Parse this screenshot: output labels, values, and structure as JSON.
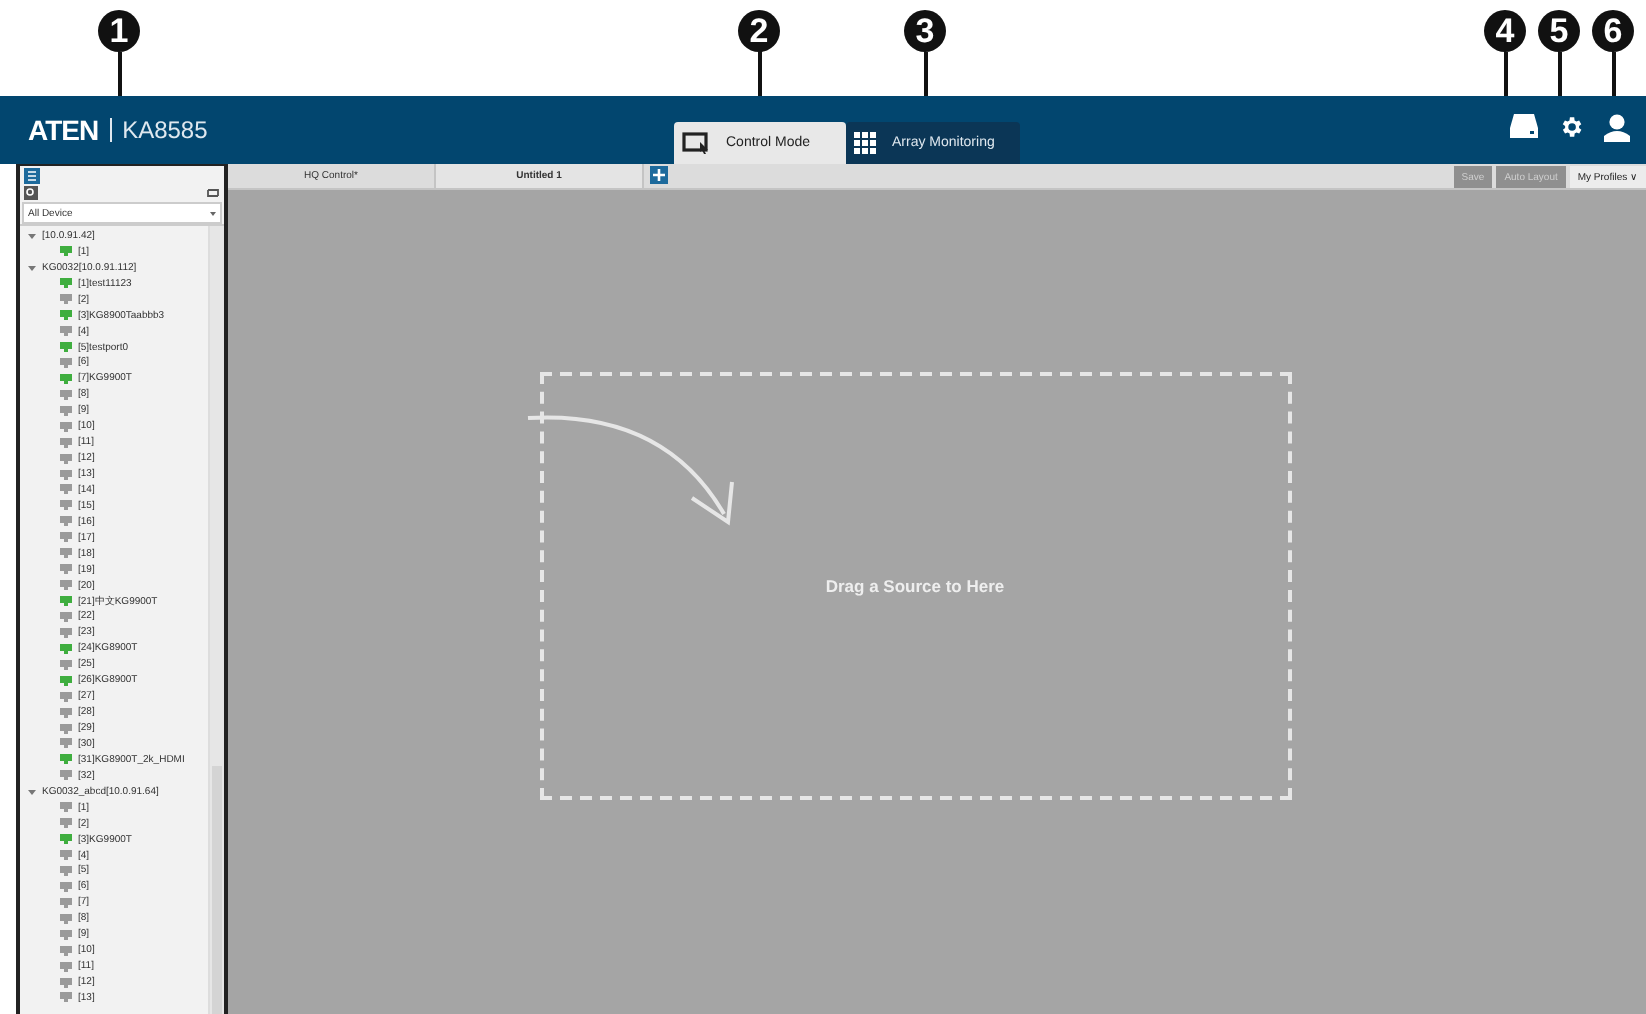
{
  "callouts": [
    "1",
    "2",
    "3",
    "4",
    "5",
    "6"
  ],
  "header": {
    "logo": "ATEN",
    "model": "KA8585"
  },
  "modes": [
    {
      "label": "Control Mode",
      "kind": "control",
      "selected": true
    },
    {
      "label": "Array Monitoring",
      "kind": "array",
      "selected": false
    }
  ],
  "layout_tabs": [
    {
      "label": "HQ Control*",
      "selected": false
    },
    {
      "label": "Untitled 1",
      "selected": true
    }
  ],
  "toolbar": {
    "save": "Save",
    "auto_layout": "Auto Layout",
    "profiles": "My Profiles ∨"
  },
  "sidebar": {
    "filter": "All Device",
    "tree": [
      {
        "label": "[10.0.91.42]",
        "expanded": true,
        "children": [
          {
            "label": "[1]",
            "online": true
          }
        ]
      },
      {
        "label": "KG0032[10.0.91.112]",
        "expanded": true,
        "children": [
          {
            "label": "[1]test11123",
            "online": true
          },
          {
            "label": "[2]",
            "online": false
          },
          {
            "label": "[3]KG8900Taabbb3",
            "online": true
          },
          {
            "label": "[4]",
            "online": false
          },
          {
            "label": "[5]testport0",
            "online": true
          },
          {
            "label": "[6]",
            "online": false
          },
          {
            "label": "[7]KG9900T",
            "online": true
          },
          {
            "label": "[8]",
            "online": false
          },
          {
            "label": "[9]",
            "online": false
          },
          {
            "label": "[10]",
            "online": false
          },
          {
            "label": "[11]",
            "online": false
          },
          {
            "label": "[12]",
            "online": false
          },
          {
            "label": "[13]",
            "online": false
          },
          {
            "label": "[14]",
            "online": false
          },
          {
            "label": "[15]",
            "online": false
          },
          {
            "label": "[16]",
            "online": false
          },
          {
            "label": "[17]",
            "online": false
          },
          {
            "label": "[18]",
            "online": false
          },
          {
            "label": "[19]",
            "online": false
          },
          {
            "label": "[20]",
            "online": false
          },
          {
            "label": "[21]中文KG9900T",
            "online": true
          },
          {
            "label": "[22]",
            "online": false
          },
          {
            "label": "[23]",
            "online": false
          },
          {
            "label": "[24]KG8900T",
            "online": true
          },
          {
            "label": "[25]",
            "online": false
          },
          {
            "label": "[26]KG8900T",
            "online": true
          },
          {
            "label": "[27]",
            "online": false
          },
          {
            "label": "[28]",
            "online": false
          },
          {
            "label": "[29]",
            "online": false
          },
          {
            "label": "[30]",
            "online": false
          },
          {
            "label": "[31]KG8900T_2k_HDMI",
            "online": true
          },
          {
            "label": "[32]",
            "online": false
          }
        ]
      },
      {
        "label": "KG0032_abcd[10.0.91.64]",
        "expanded": true,
        "children": [
          {
            "label": "[1]",
            "online": false
          },
          {
            "label": "[2]",
            "online": false
          },
          {
            "label": "[3]KG9900T",
            "online": true
          },
          {
            "label": "[4]",
            "online": false
          },
          {
            "label": "[5]",
            "online": false
          },
          {
            "label": "[6]",
            "online": false
          },
          {
            "label": "[7]",
            "online": false
          },
          {
            "label": "[8]",
            "online": false
          },
          {
            "label": "[9]",
            "online": false
          },
          {
            "label": "[10]",
            "online": false
          },
          {
            "label": "[11]",
            "online": false
          },
          {
            "label": "[12]",
            "online": false
          },
          {
            "label": "[13]",
            "online": false
          }
        ]
      }
    ]
  },
  "canvas": {
    "hint": "Drag a Source to Here"
  }
}
